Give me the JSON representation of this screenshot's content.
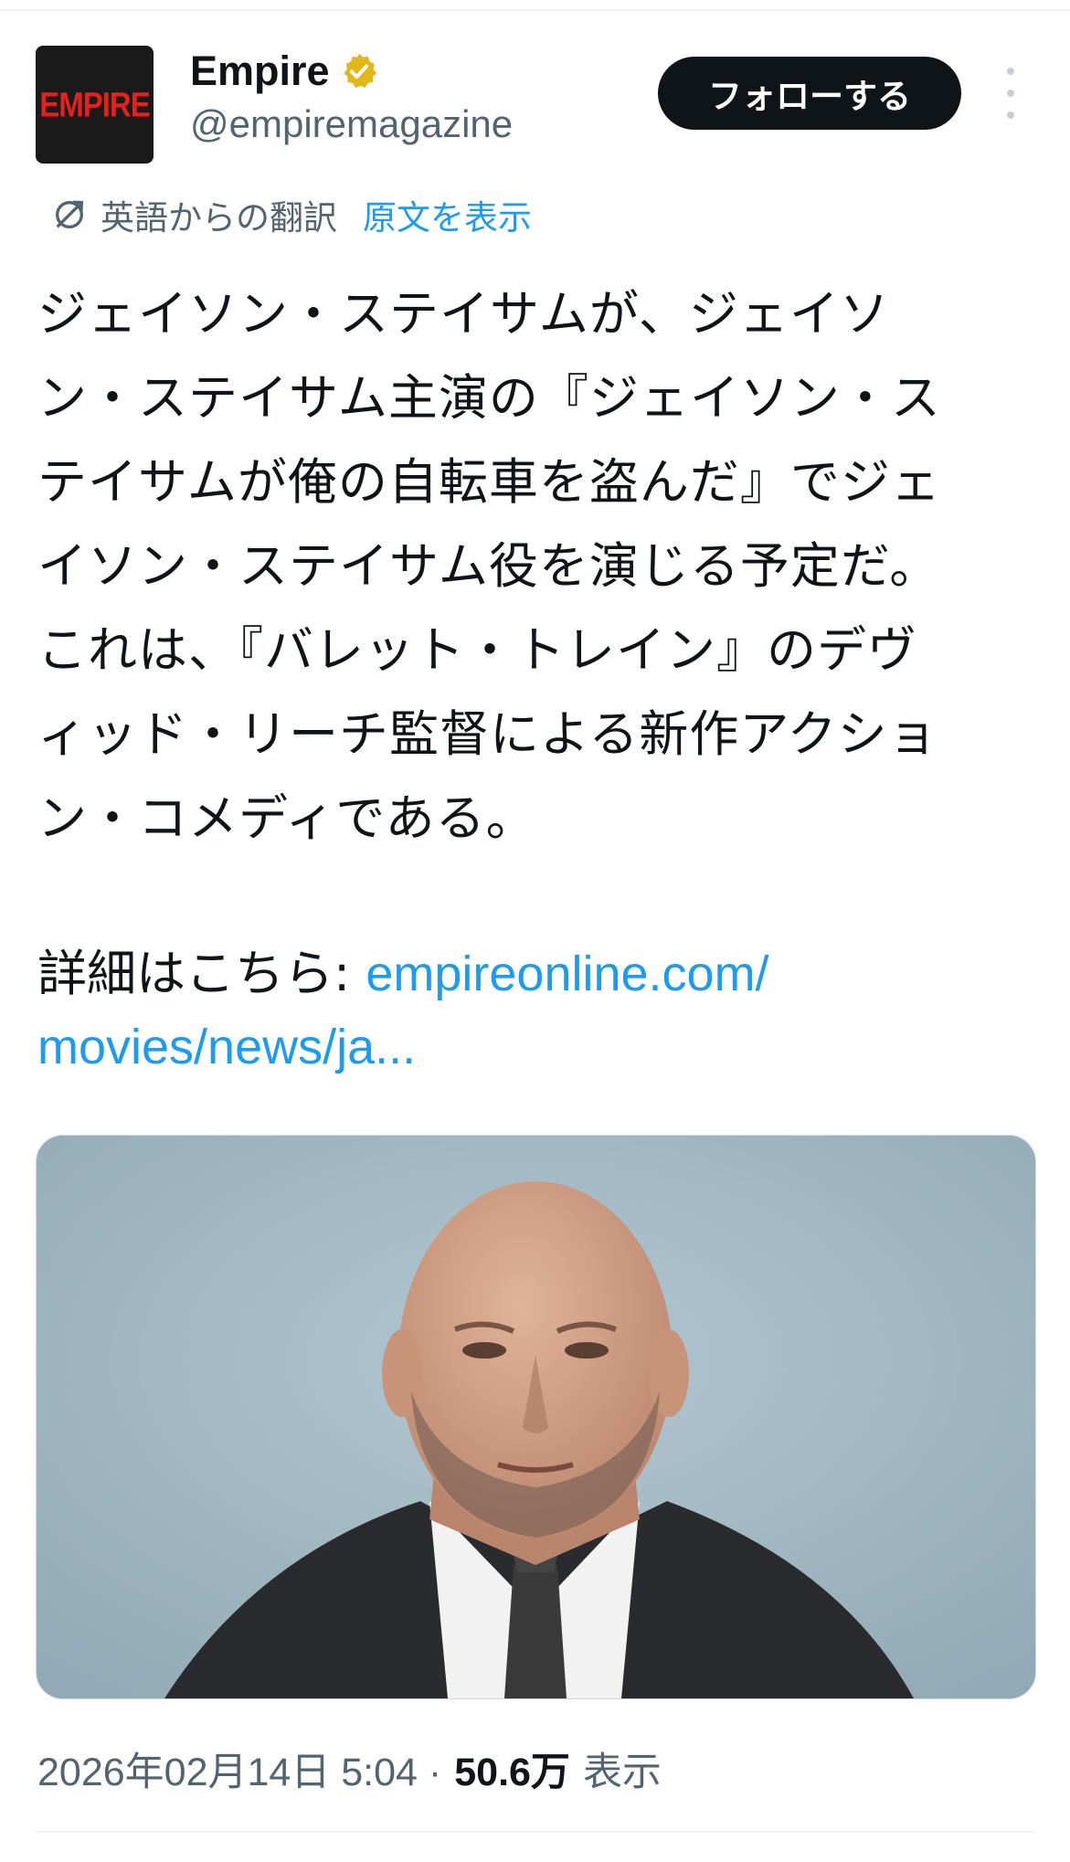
{
  "author": {
    "avatar_text": "EMPIRE",
    "display_name": "Empire",
    "handle": "@empiremagazine",
    "verified": true,
    "badge_color": "#e2b719"
  },
  "follow_label": "フォローする",
  "translation": {
    "label": "英語からの翻訳",
    "show_original": "原文を表示"
  },
  "tweet": {
    "lines": [
      "ジェイソン・ステイサムが、ジェイソ",
      "ン・ステイサム主演の『ジェイソン・ス",
      "テイサムが俺の自転車を盗んだ』でジェ",
      "イソン・ステイサム役を演じる予定だ。",
      "これは、『バレット・トレイン』のデヴ",
      "ィッド・リーチ監督による新作アクショ",
      "ン・コメディである。"
    ],
    "more_prefix": "詳細はこちら: ",
    "link_line1": "empireonline.com/",
    "link_line2": "movies/news/ja..."
  },
  "meta": {
    "datetime": "2026年02月14日 5:04 ·",
    "views": "50.6万",
    "views_label": "表示"
  },
  "colors": {
    "text": "#0f1419",
    "secondary": "#536471",
    "link": "#1d9bf0",
    "avatar_red": "#e3211f"
  }
}
